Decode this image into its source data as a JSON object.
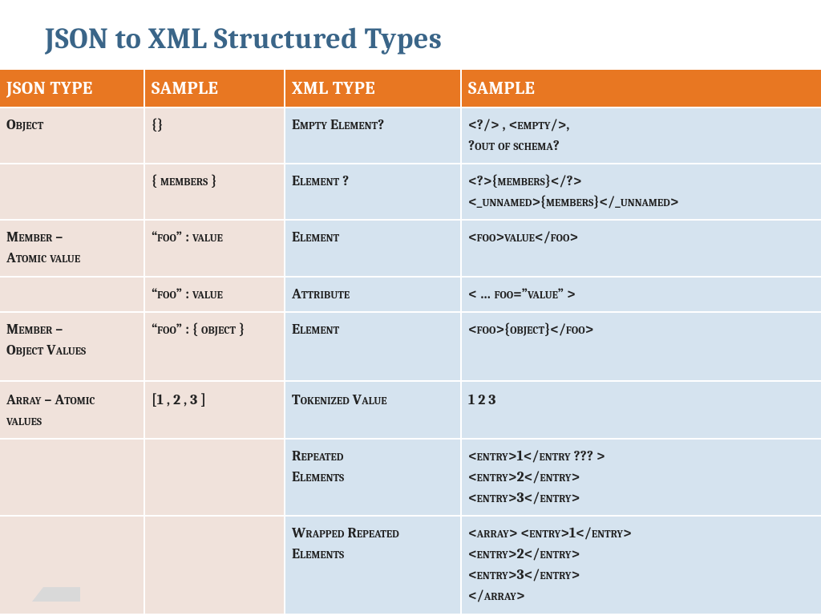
{
  "title": "JSON to XML Structured Types",
  "headers": [
    "JSON Type",
    "Sample",
    "XML Type",
    "Sample"
  ],
  "rows": [
    {
      "c1": "Object",
      "c2": "{}",
      "c3": "Empty Element?",
      "c4_lines": [
        "<?/> , <empty/>,",
        "?out of schema?"
      ]
    },
    {
      "c1": "",
      "c2": "{ members }",
      "c3": "Element ?",
      "c4_lines": [
        "<?>{members}</?>",
        "<_unnamed>{members}</_unnamed>"
      ]
    },
    {
      "c1_lines": [
        "Member –",
        "Atomic value"
      ],
      "c2": "“foo” : value",
      "c3": "Element",
      "c4": "<foo>value</foo>"
    },
    {
      "c1": "",
      "c2": "“foo” : value",
      "c3": "Attribute",
      "c4": "< …   foo=”value” >"
    },
    {
      "c1_lines": [
        "Member –",
        "Object Values",
        ""
      ],
      "c2": "“foo” : { object }",
      "c3": "Element",
      "c4": "<foo>{object}</foo>"
    },
    {
      "c1_lines": [
        "Array – Atomic",
        "values"
      ],
      "c2": "[1 , 2 , 3 ]",
      "c3": "Tokenized Value",
      "c4": "1 2 3"
    },
    {
      "c1": "",
      "c2": "",
      "c3_lines": [
        "Repeated",
        "Elements"
      ],
      "c4_lines": [
        "<entry>1</entry ??? >",
        "<entry>2</entry>",
        "<entry>3</entry>"
      ]
    },
    {
      "c1": "",
      "c2": "",
      "c3_lines": [
        "Wrapped Repeated",
        "Elements"
      ],
      "c4_lines": [
        "<array>  <entry>1</entry>",
        "   <entry>2</entry>",
        "   <entry>3</entry>",
        "</array>"
      ]
    }
  ]
}
